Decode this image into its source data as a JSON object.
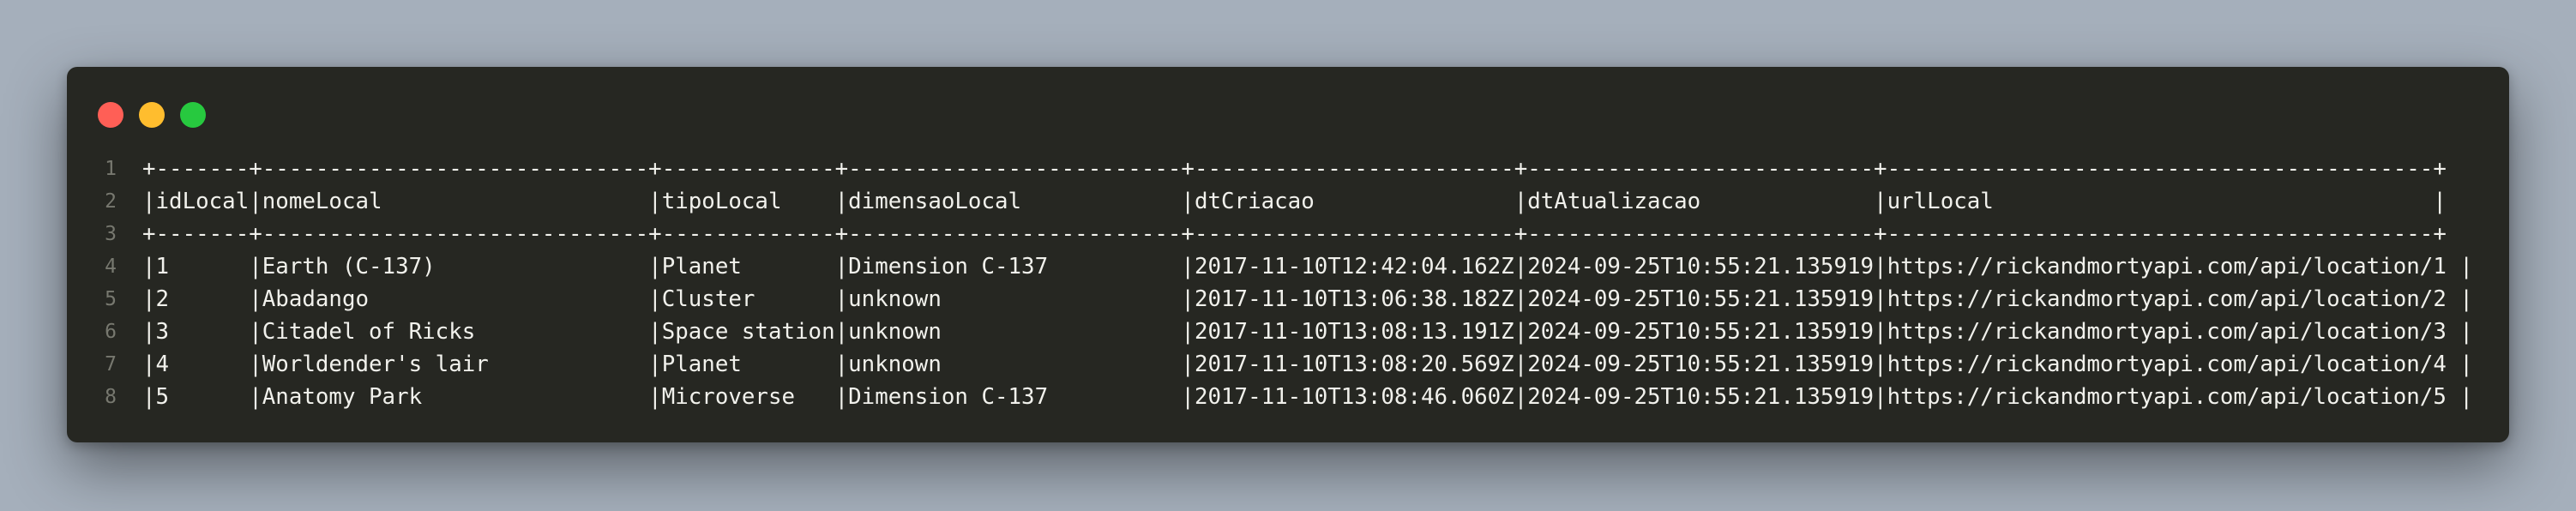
{
  "window": {
    "controls": [
      "close",
      "minimize",
      "zoom"
    ],
    "colors": {
      "background": "#262722",
      "text": "#f1f1ec",
      "line_number": "#77786f",
      "close": "#ff5f56",
      "minimize": "#ffbd2e",
      "zoom": "#27c93f"
    }
  },
  "code": {
    "lines": [
      {
        "number": "1",
        "text": "+-------+-----------------------------+-------------+-------------------------+------------------------+--------------------------+-----------------------------------------+"
      },
      {
        "number": "2",
        "text": "|idLocal|nomeLocal                    |tipoLocal    |dimensaoLocal            |dtCriacao               |dtAtualizacao             |urlLocal                                 |"
      },
      {
        "number": "3",
        "text": "+-------+-----------------------------+-------------+-------------------------+------------------------+--------------------------+-----------------------------------------+"
      },
      {
        "number": "4",
        "text": "|1      |Earth (C-137)                |Planet       |Dimension C-137          |2017-11-10T12:42:04.162Z|2024-09-25T10:55:21.135919|https://rickandmortyapi.com/api/location/1 |"
      },
      {
        "number": "5",
        "text": "|2      |Abadango                     |Cluster      |unknown                  |2017-11-10T13:06:38.182Z|2024-09-25T10:55:21.135919|https://rickandmortyapi.com/api/location/2 |"
      },
      {
        "number": "6",
        "text": "|3      |Citadel of Ricks             |Space station|unknown                  |2017-11-10T13:08:13.191Z|2024-09-25T10:55:21.135919|https://rickandmortyapi.com/api/location/3 |"
      },
      {
        "number": "7",
        "text": "|4      |Worldender's lair            |Planet       |unknown                  |2017-11-10T13:08:20.569Z|2024-09-25T10:55:21.135919|https://rickandmortyapi.com/api/location/4 |"
      },
      {
        "number": "8",
        "text": "|5      |Anatomy Park                 |Microverse   |Dimension C-137          |2017-11-10T13:08:46.060Z|2024-09-25T10:55:21.135919|https://rickandmortyapi.com/api/location/5 |"
      }
    ]
  }
}
